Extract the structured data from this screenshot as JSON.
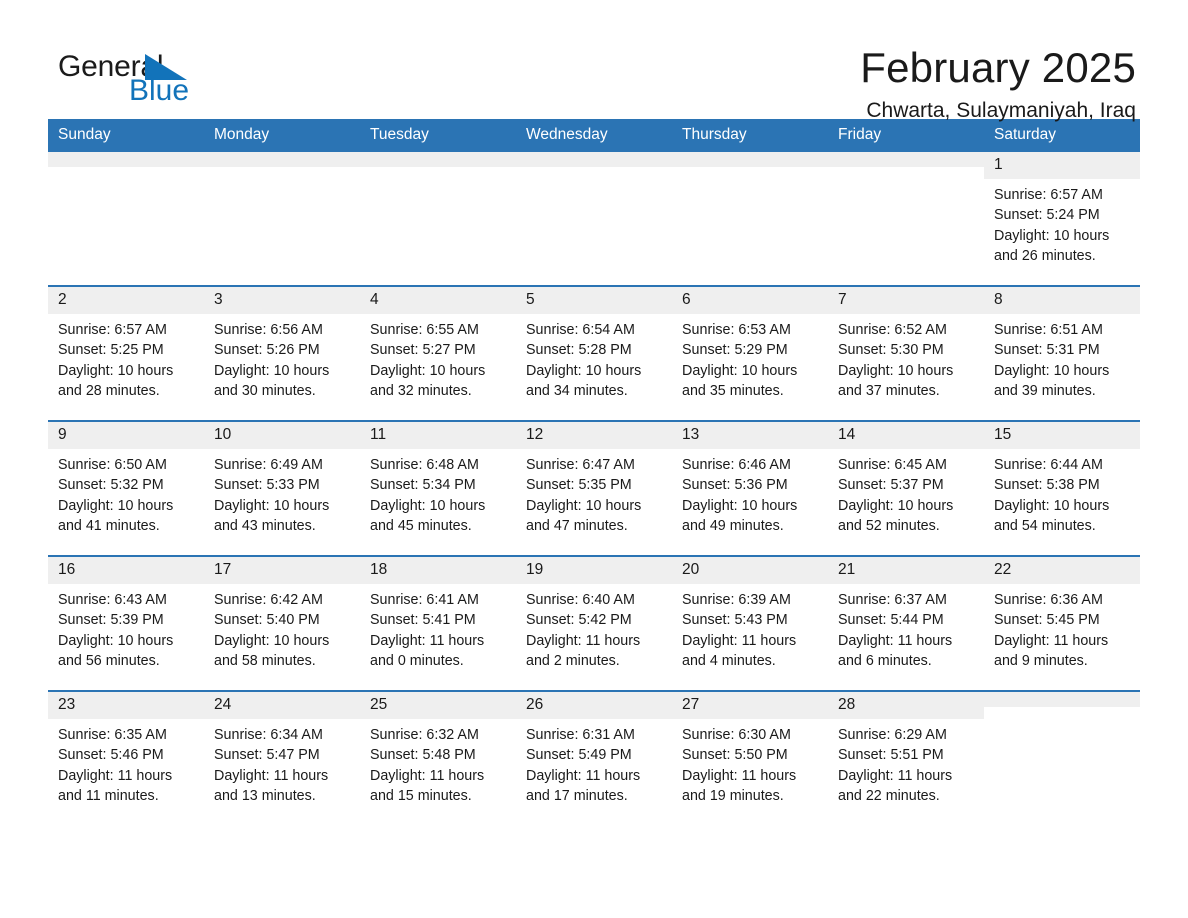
{
  "logo": {
    "word_one": "General",
    "word_two": "Blue",
    "triangle_color": "#1273ba",
    "text_color": "#1b1b1b"
  },
  "header": {
    "title": "February 2025",
    "subtitle": "Chwarta, Sulaymaniyah, Iraq"
  },
  "theme": {
    "header_blue": "#2b74b4",
    "daynum_band": "#efefef",
    "page_background": "#ffffff",
    "text": "#1a1a1a"
  },
  "weekday_headers": [
    "Sunday",
    "Monday",
    "Tuesday",
    "Wednesday",
    "Thursday",
    "Friday",
    "Saturday"
  ],
  "weeks": [
    [
      {
        "day": "",
        "empty": true
      },
      {
        "day": "",
        "empty": true
      },
      {
        "day": "",
        "empty": true
      },
      {
        "day": "",
        "empty": true
      },
      {
        "day": "",
        "empty": true
      },
      {
        "day": "",
        "empty": true
      },
      {
        "day": "1",
        "sunrise": "Sunrise: 6:57 AM",
        "sunset": "Sunset: 5:24 PM",
        "daylight_line1": "Daylight: 10 hours",
        "daylight_line2": "and 26 minutes."
      }
    ],
    [
      {
        "day": "2",
        "sunrise": "Sunrise: 6:57 AM",
        "sunset": "Sunset: 5:25 PM",
        "daylight_line1": "Daylight: 10 hours",
        "daylight_line2": "and 28 minutes."
      },
      {
        "day": "3",
        "sunrise": "Sunrise: 6:56 AM",
        "sunset": "Sunset: 5:26 PM",
        "daylight_line1": "Daylight: 10 hours",
        "daylight_line2": "and 30 minutes."
      },
      {
        "day": "4",
        "sunrise": "Sunrise: 6:55 AM",
        "sunset": "Sunset: 5:27 PM",
        "daylight_line1": "Daylight: 10 hours",
        "daylight_line2": "and 32 minutes."
      },
      {
        "day": "5",
        "sunrise": "Sunrise: 6:54 AM",
        "sunset": "Sunset: 5:28 PM",
        "daylight_line1": "Daylight: 10 hours",
        "daylight_line2": "and 34 minutes."
      },
      {
        "day": "6",
        "sunrise": "Sunrise: 6:53 AM",
        "sunset": "Sunset: 5:29 PM",
        "daylight_line1": "Daylight: 10 hours",
        "daylight_line2": "and 35 minutes."
      },
      {
        "day": "7",
        "sunrise": "Sunrise: 6:52 AM",
        "sunset": "Sunset: 5:30 PM",
        "daylight_line1": "Daylight: 10 hours",
        "daylight_line2": "and 37 minutes."
      },
      {
        "day": "8",
        "sunrise": "Sunrise: 6:51 AM",
        "sunset": "Sunset: 5:31 PM",
        "daylight_line1": "Daylight: 10 hours",
        "daylight_line2": "and 39 minutes."
      }
    ],
    [
      {
        "day": "9",
        "sunrise": "Sunrise: 6:50 AM",
        "sunset": "Sunset: 5:32 PM",
        "daylight_line1": "Daylight: 10 hours",
        "daylight_line2": "and 41 minutes."
      },
      {
        "day": "10",
        "sunrise": "Sunrise: 6:49 AM",
        "sunset": "Sunset: 5:33 PM",
        "daylight_line1": "Daylight: 10 hours",
        "daylight_line2": "and 43 minutes."
      },
      {
        "day": "11",
        "sunrise": "Sunrise: 6:48 AM",
        "sunset": "Sunset: 5:34 PM",
        "daylight_line1": "Daylight: 10 hours",
        "daylight_line2": "and 45 minutes."
      },
      {
        "day": "12",
        "sunrise": "Sunrise: 6:47 AM",
        "sunset": "Sunset: 5:35 PM",
        "daylight_line1": "Daylight: 10 hours",
        "daylight_line2": "and 47 minutes."
      },
      {
        "day": "13",
        "sunrise": "Sunrise: 6:46 AM",
        "sunset": "Sunset: 5:36 PM",
        "daylight_line1": "Daylight: 10 hours",
        "daylight_line2": "and 49 minutes."
      },
      {
        "day": "14",
        "sunrise": "Sunrise: 6:45 AM",
        "sunset": "Sunset: 5:37 PM",
        "daylight_line1": "Daylight: 10 hours",
        "daylight_line2": "and 52 minutes."
      },
      {
        "day": "15",
        "sunrise": "Sunrise: 6:44 AM",
        "sunset": "Sunset: 5:38 PM",
        "daylight_line1": "Daylight: 10 hours",
        "daylight_line2": "and 54 minutes."
      }
    ],
    [
      {
        "day": "16",
        "sunrise": "Sunrise: 6:43 AM",
        "sunset": "Sunset: 5:39 PM",
        "daylight_line1": "Daylight: 10 hours",
        "daylight_line2": "and 56 minutes."
      },
      {
        "day": "17",
        "sunrise": "Sunrise: 6:42 AM",
        "sunset": "Sunset: 5:40 PM",
        "daylight_line1": "Daylight: 10 hours",
        "daylight_line2": "and 58 minutes."
      },
      {
        "day": "18",
        "sunrise": "Sunrise: 6:41 AM",
        "sunset": "Sunset: 5:41 PM",
        "daylight_line1": "Daylight: 11 hours",
        "daylight_line2": "and 0 minutes."
      },
      {
        "day": "19",
        "sunrise": "Sunrise: 6:40 AM",
        "sunset": "Sunset: 5:42 PM",
        "daylight_line1": "Daylight: 11 hours",
        "daylight_line2": "and 2 minutes."
      },
      {
        "day": "20",
        "sunrise": "Sunrise: 6:39 AM",
        "sunset": "Sunset: 5:43 PM",
        "daylight_line1": "Daylight: 11 hours",
        "daylight_line2": "and 4 minutes."
      },
      {
        "day": "21",
        "sunrise": "Sunrise: 6:37 AM",
        "sunset": "Sunset: 5:44 PM",
        "daylight_line1": "Daylight: 11 hours",
        "daylight_line2": "and 6 minutes."
      },
      {
        "day": "22",
        "sunrise": "Sunrise: 6:36 AM",
        "sunset": "Sunset: 5:45 PM",
        "daylight_line1": "Daylight: 11 hours",
        "daylight_line2": "and 9 minutes."
      }
    ],
    [
      {
        "day": "23",
        "sunrise": "Sunrise: 6:35 AM",
        "sunset": "Sunset: 5:46 PM",
        "daylight_line1": "Daylight: 11 hours",
        "daylight_line2": "and 11 minutes."
      },
      {
        "day": "24",
        "sunrise": "Sunrise: 6:34 AM",
        "sunset": "Sunset: 5:47 PM",
        "daylight_line1": "Daylight: 11 hours",
        "daylight_line2": "and 13 minutes."
      },
      {
        "day": "25",
        "sunrise": "Sunrise: 6:32 AM",
        "sunset": "Sunset: 5:48 PM",
        "daylight_line1": "Daylight: 11 hours",
        "daylight_line2": "and 15 minutes."
      },
      {
        "day": "26",
        "sunrise": "Sunrise: 6:31 AM",
        "sunset": "Sunset: 5:49 PM",
        "daylight_line1": "Daylight: 11 hours",
        "daylight_line2": "and 17 minutes."
      },
      {
        "day": "27",
        "sunrise": "Sunrise: 6:30 AM",
        "sunset": "Sunset: 5:50 PM",
        "daylight_line1": "Daylight: 11 hours",
        "daylight_line2": "and 19 minutes."
      },
      {
        "day": "28",
        "sunrise": "Sunrise: 6:29 AM",
        "sunset": "Sunset: 5:51 PM",
        "daylight_line1": "Daylight: 11 hours",
        "daylight_line2": "and 22 minutes."
      },
      {
        "day": "",
        "empty": true
      }
    ]
  ]
}
